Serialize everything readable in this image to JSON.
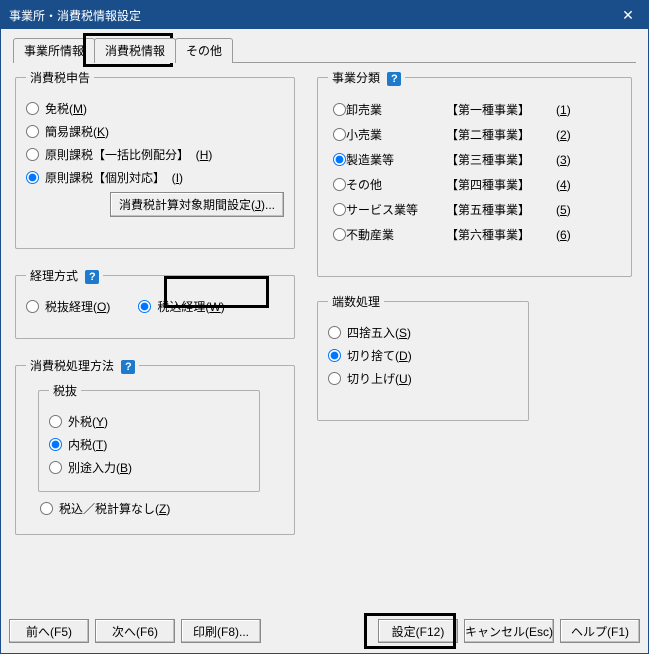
{
  "title": "事業所・消費税情報設定",
  "tabs": {
    "t0": "事業所情報",
    "t1": "消費税情報",
    "t2": "その他"
  },
  "tax_return": {
    "legend": "消費税申告",
    "opt0": "免税",
    "sc0": "M",
    "opt1": "簡易課税",
    "sc1": "K",
    "opt2": "原則課税【一括比例配分】",
    "sc2": "H",
    "opt3": "原則課税【個別対応】",
    "sc3": "I",
    "btn": "消費税計算対象期間設定",
    "btn_sc": "J"
  },
  "method": {
    "legend": "経理方式",
    "opt0": "税抜経理",
    "sc0": "O",
    "opt1": "税込経理",
    "sc1": "W"
  },
  "processing": {
    "legend": "消費税処理方法",
    "sub_legend": "税抜",
    "opt0": "外税",
    "sc0": "Y",
    "opt1": "内税",
    "sc1": "T",
    "opt2": "別途入力",
    "sc2": "B",
    "opt3": "税込／税計算なし",
    "sc3": "Z"
  },
  "category": {
    "legend": "事業分類",
    "rows": [
      {
        "label": "卸売業",
        "class": "【第一種事業】",
        "sc": "1"
      },
      {
        "label": "小売業",
        "class": "【第二種事業】",
        "sc": "2"
      },
      {
        "label": "製造業等",
        "class": "【第三種事業】",
        "sc": "3"
      },
      {
        "label": "その他",
        "class": "【第四種事業】",
        "sc": "4"
      },
      {
        "label": "サービス業等",
        "class": "【第五種事業】",
        "sc": "5"
      },
      {
        "label": "不動産業",
        "class": "【第六種事業】",
        "sc": "6"
      }
    ]
  },
  "rounding": {
    "legend": "端数処理",
    "opt0": "四捨五入",
    "sc0": "S",
    "opt1": "切り捨て",
    "sc1": "D",
    "opt2": "切り上げ",
    "sc2": "U"
  },
  "footer": {
    "prev": "前へ(F5)",
    "next": "次へ(F6)",
    "print": "印刷(F8)...",
    "set": "設定(F12)",
    "cancel": "キャンセル(Esc)",
    "help": "ヘルプ(F1)"
  },
  "help_glyph": "?"
}
